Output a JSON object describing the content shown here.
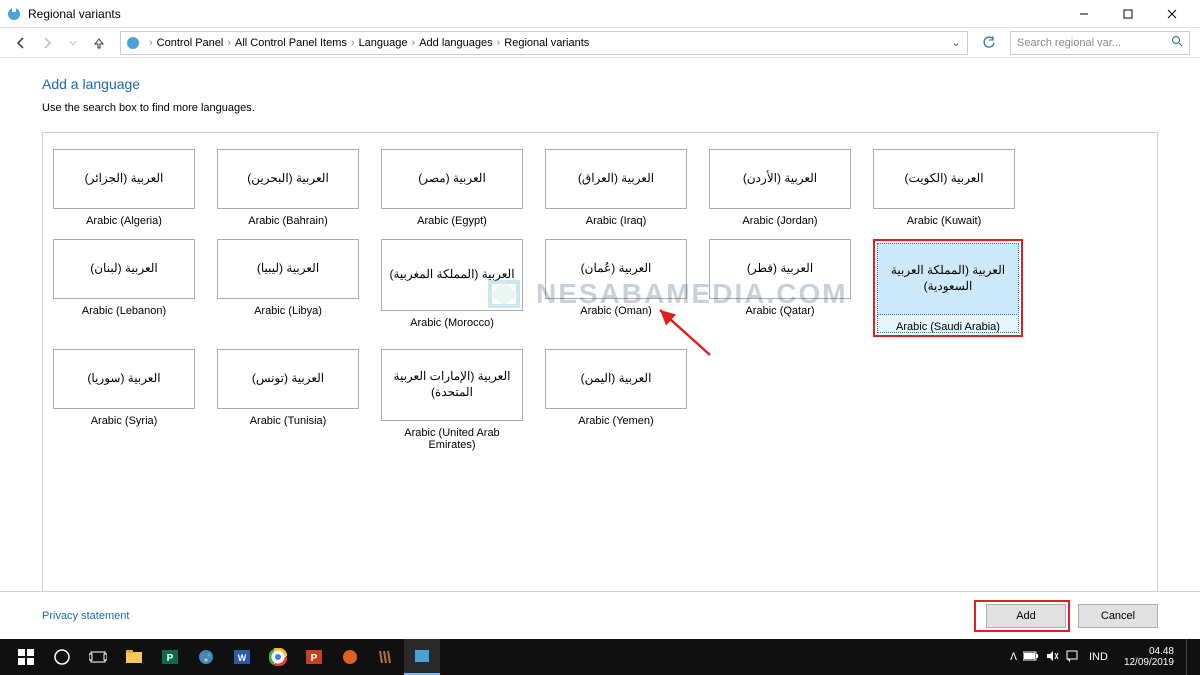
{
  "window": {
    "title": "Regional variants"
  },
  "breadcrumbs": [
    "Control Panel",
    "All Control Panel Items",
    "Language",
    "Add languages",
    "Regional variants"
  ],
  "search": {
    "placeholder": "Search regional var..."
  },
  "page": {
    "heading": "Add a language",
    "subhead": "Use the search box to find more languages."
  },
  "tiles": [
    {
      "native": "العربية (الجزائر)",
      "label": "Arabic (Algeria)"
    },
    {
      "native": "العربية (البحرين)",
      "label": "Arabic (Bahrain)"
    },
    {
      "native": "العربية (مصر)",
      "label": "Arabic (Egypt)"
    },
    {
      "native": "العربية (العراق)",
      "label": "Arabic (Iraq)"
    },
    {
      "native": "العربية (الأردن)",
      "label": "Arabic (Jordan)"
    },
    {
      "native": "العربية (الكويت)",
      "label": "Arabic (Kuwait)"
    },
    {
      "native": "العربية (لبنان)",
      "label": "Arabic (Lebanon)"
    },
    {
      "native": "العربية (ليبيا)",
      "label": "Arabic (Libya)"
    },
    {
      "native": "العربية (المملكة المغربية)",
      "label": "Arabic (Morocco)",
      "tall": true
    },
    {
      "native": "العربية (عُمان)",
      "label": "Arabic (Oman)"
    },
    {
      "native": "العربية (قطر)",
      "label": "Arabic (Qatar)"
    },
    {
      "native": "العربية (المملكة العربية السعودية)",
      "label": "Arabic (Saudi Arabia)",
      "tall": true,
      "selected": true,
      "highlight": true
    },
    {
      "native": "العربية (سوريا)",
      "label": "Arabic (Syria)"
    },
    {
      "native": "العربية (تونس)",
      "label": "Arabic (Tunisia)"
    },
    {
      "native": "العربية (الإمارات العربية المتحدة)",
      "label": "Arabic (United Arab Emirates)",
      "tall": true
    },
    {
      "native": "العربية (اليمن)",
      "label": "Arabic (Yemen)"
    }
  ],
  "footer": {
    "privacy": "Privacy statement",
    "add": "Add",
    "cancel": "Cancel"
  },
  "taskbar": {
    "lang": "IND",
    "time": "04.48",
    "date": "12/09/2019"
  },
  "watermark": "NESABAMEDIA.COM"
}
